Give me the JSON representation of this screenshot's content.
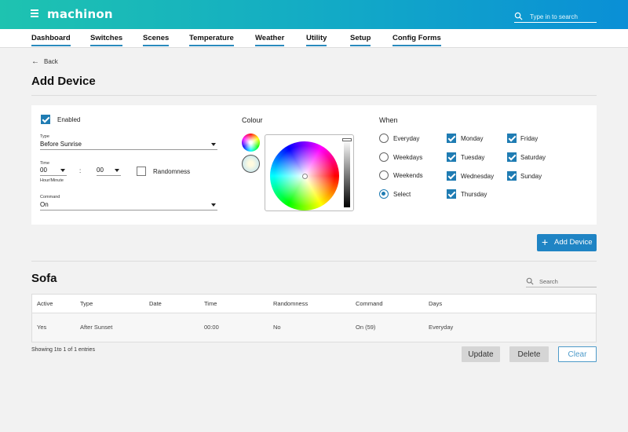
{
  "header": {
    "brand": "machinon",
    "search_placeholder": "Type in to search"
  },
  "nav": {
    "items": [
      {
        "label": "Dashboard"
      },
      {
        "label": "Switches"
      },
      {
        "label": "Scenes"
      },
      {
        "label": "Temperature"
      },
      {
        "label": "Weather"
      },
      {
        "label": "Utility"
      },
      {
        "label": "Setup"
      },
      {
        "label": "Config Forms"
      }
    ]
  },
  "back_label": "Back",
  "page_title": "Add Device",
  "form": {
    "enabled_label": "Enabled",
    "enabled": true,
    "type_label": "Type",
    "type_value": "Before Sunrise",
    "time_label": "Time",
    "hour_value": "00",
    "separator": ":",
    "minute_value": "00",
    "time_hint": "Hour/Minute",
    "randomness_label": "Randomness",
    "randomness": false,
    "command_label": "Command",
    "command_value": "On",
    "colour_label": "Colour",
    "when_label": "When",
    "when_options": [
      {
        "label": "Everyday",
        "selected": false
      },
      {
        "label": "Weekdays",
        "selected": false
      },
      {
        "label": "Weekends",
        "selected": false
      },
      {
        "label": "Select",
        "selected": true
      }
    ],
    "days": [
      {
        "label": "Monday",
        "checked": true
      },
      {
        "label": "Tuesday",
        "checked": true
      },
      {
        "label": "Wednesday",
        "checked": true
      },
      {
        "label": "Thursday",
        "checked": true
      },
      {
        "label": "Friday",
        "checked": true
      },
      {
        "label": "Saturday",
        "checked": true
      },
      {
        "label": "Sunday",
        "checked": true
      }
    ]
  },
  "add_device_button": "Add Device",
  "section_title": "Sofa",
  "table_search_placeholder": "Search",
  "table": {
    "headers": [
      "Active",
      "Type",
      "Date",
      "Time",
      "Randomness",
      "Command",
      "Days"
    ],
    "rows": [
      [
        "Yes",
        "After Sunset",
        "",
        "00:00",
        "No",
        "On (59)",
        "Everyday"
      ]
    ]
  },
  "entries_text": "Showing 1to 1 of 1 entries",
  "actions": {
    "update": "Update",
    "delete": "Delete",
    "clear": "Clear"
  },
  "colors": {
    "accent": "#1f84c4",
    "header_start": "#1ec3b0",
    "header_end": "#0a8fd6"
  }
}
